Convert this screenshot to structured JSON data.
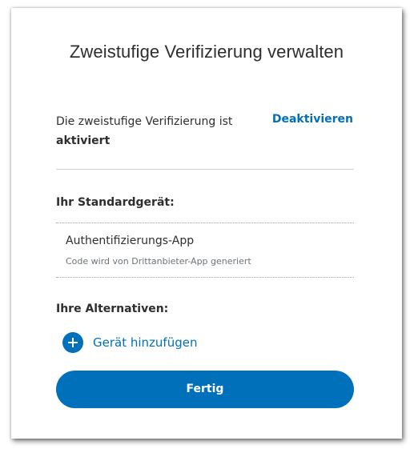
{
  "dialog": {
    "title": "Zweistufige Verifizierung verwalten",
    "status": {
      "text": "Die zweistufige Verifizierung ist",
      "value": "aktiviert",
      "action_label": "Deaktivieren"
    },
    "default_device": {
      "heading": "Ihr Standardgerät:",
      "name": "Authentifizierungs-App",
      "description": "Code wird von Drittanbieter-App generiert"
    },
    "alternatives": {
      "heading": "Ihre Alternativen:",
      "add_label": "Gerät hinzufügen",
      "add_icon": "plus-circle-icon"
    },
    "done_label": "Fertig"
  },
  "colors": {
    "accent": "#0070ba",
    "text": "#2c2e2f",
    "muted": "#6c7378"
  }
}
